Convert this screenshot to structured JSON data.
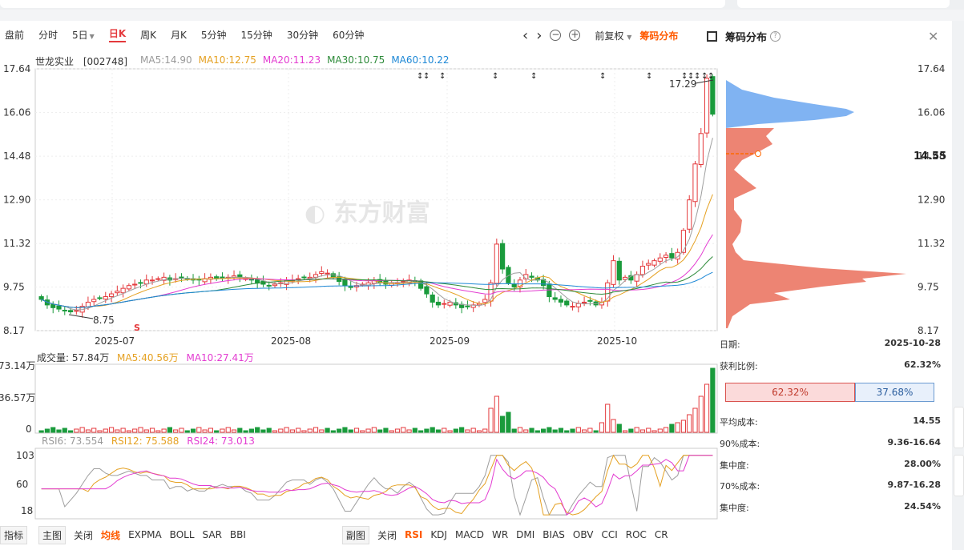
{
  "tabs": [
    {
      "label": "盘前"
    },
    {
      "label": "分时"
    },
    {
      "label": "5日"
    },
    {
      "label": "日K"
    },
    {
      "label": "周K"
    },
    {
      "label": "月K"
    },
    {
      "label": "5分钟"
    },
    {
      "label": "15分钟"
    },
    {
      "label": "30分钟"
    },
    {
      "label": "60分钟"
    }
  ],
  "tools": {
    "prev": "‹",
    "next": "›",
    "zoom_out": "−",
    "zoom_in": "+",
    "adjust": "前复权",
    "chip_dist": "筹码分布"
  },
  "right_title": "筹码分布",
  "stock": {
    "name": "世龙实业",
    "code": "[002748]"
  },
  "ma": {
    "ma5": "MA5:14.90",
    "ma10": "MA10:12.75",
    "ma20": "MA20:11.23",
    "ma30": "MA30:10.75",
    "ma60": "MA60:10.22"
  },
  "colors": {
    "up": "#e4393c",
    "down": "#1a9b3c",
    "ma5": "#9e9e9e",
    "ma10": "#e5a122",
    "ma20": "#e33cd1",
    "ma30": "#2e8b3a",
    "ma60": "#1e88d6",
    "chip_profit": "#ea6f5a",
    "chip_loss": "#6aa6f0"
  },
  "price_axis": [
    "17.64",
    "16.06",
    "14.48",
    "12.90",
    "11.32",
    "9.75",
    "8.17"
  ],
  "date_axis": [
    "2025-07",
    "2025-08",
    "2025-09",
    "2025-10"
  ],
  "annotations": {
    "high": "17.29",
    "low": "8.75",
    "watermark": "东方财富",
    "s_mark": "S",
    "avg_cost_marker": "14.55"
  },
  "volume": {
    "legend": "成交量: 57.84万",
    "ma5": "MA5:40.56万",
    "ma10": "MA10:27.41万",
    "axis": [
      "73.14万",
      "36.57万",
      "0"
    ]
  },
  "rsi": {
    "rsi6": "RSI6: 73.554",
    "rsi12": "RSI12: 75.588",
    "rsi24": "RSI24: 73.013",
    "axis": [
      "103",
      "60",
      "18"
    ]
  },
  "info": {
    "date_label": "日期:",
    "date": "2025-10-28",
    "profit_label": "获利比例:",
    "profit": "62.32%",
    "ratio_profit": "62.32%",
    "ratio_loss": "37.68%",
    "avg_label": "平均成本:",
    "avg": "14.55",
    "cost90_label": "90%成本:",
    "cost90": "9.36-16.64",
    "conc1_label": "集中度:",
    "conc1": "28.00%",
    "cost70_label": "70%成本:",
    "cost70": "9.87-16.28",
    "conc2_label": "集中度:",
    "conc2": "24.54%"
  },
  "bottom": {
    "main_items": [
      "指标",
      "主图",
      "关闭",
      "均线",
      "EXPMA",
      "BOLL",
      "SAR",
      "BBI"
    ],
    "sub_items": [
      "副图",
      "关闭",
      "RSI",
      "KDJ",
      "MACD",
      "WR",
      "DMI",
      "BIAS",
      "OBV",
      "CCI",
      "ROC",
      "CR"
    ]
  },
  "chart_data": {
    "type": "candlestick",
    "ylim": [
      8.17,
      17.64
    ],
    "x_ticks": [
      "2025-07",
      "2025-08",
      "2025-09",
      "2025-10"
    ],
    "candles_close": [
      9.3,
      9.1,
      9.0,
      8.95,
      8.9,
      8.85,
      8.9,
      9.05,
      9.2,
      9.3,
      9.35,
      9.4,
      9.5,
      9.6,
      9.7,
      9.8,
      9.85,
      9.9,
      10.0,
      10.0,
      10.05,
      10.1,
      10.0,
      10.05,
      10.1,
      10.05,
      10.0,
      10.0,
      10.05,
      10.1,
      10.05,
      10.1,
      10.1,
      10.15,
      10.1,
      10.05,
      10.0,
      9.9,
      9.85,
      9.8,
      9.85,
      9.9,
      10.0,
      10.0,
      10.05,
      10.1,
      10.1,
      10.2,
      10.3,
      10.25,
      10.1,
      9.95,
      9.8,
      9.75,
      9.8,
      9.85,
      9.9,
      10.0,
      9.9,
      9.85,
      9.9,
      9.9,
      9.95,
      10.0,
      9.95,
      9.7,
      9.5,
      9.2,
      9.1,
      9.15,
      9.2,
      9.1,
      9.0,
      9.05,
      9.1,
      9.15,
      9.3,
      9.9,
      11.3,
      10.4,
      9.9,
      9.75,
      10.0,
      10.2,
      10.1,
      10.0,
      9.8,
      9.4,
      9.3,
      9.2,
      9.1,
      9.05,
      9.15,
      9.2,
      9.25,
      9.1,
      9.2,
      9.9,
      10.7,
      10.0,
      10.1,
      10.0,
      10.2,
      10.5,
      10.6,
      10.7,
      10.8,
      10.9,
      10.8,
      11.0,
      11.8,
      12.9,
      14.2,
      15.3,
      17.3,
      16.0
    ],
    "chip_distribution": {
      "profit_ratio": 62.32,
      "avg_cost": 14.55
    }
  }
}
